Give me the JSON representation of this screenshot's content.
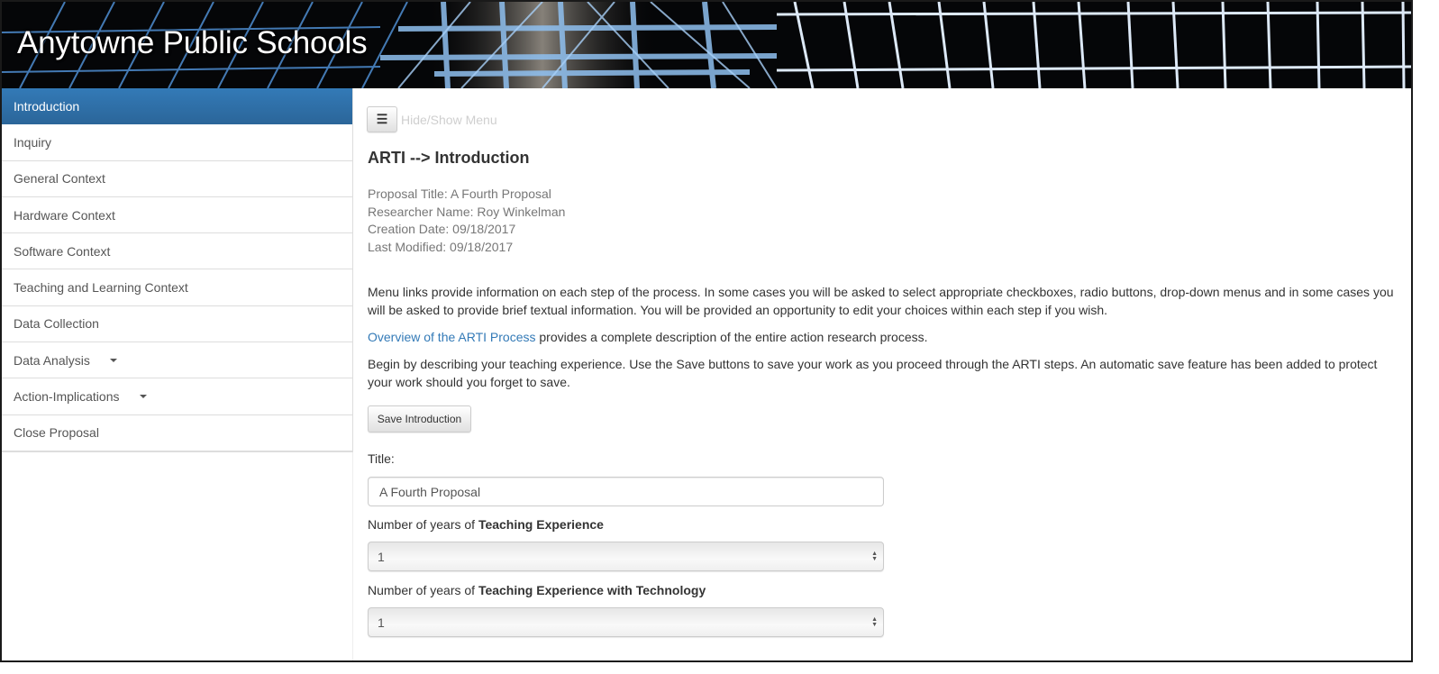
{
  "header": {
    "site_title": "Anytowne Public Schools"
  },
  "sidebar": {
    "items": [
      {
        "label": "Introduction",
        "active": true,
        "has_dropdown": false
      },
      {
        "label": "Inquiry",
        "active": false,
        "has_dropdown": false
      },
      {
        "label": "General Context",
        "active": false,
        "has_dropdown": false
      },
      {
        "label": "Hardware Context",
        "active": false,
        "has_dropdown": false
      },
      {
        "label": "Software Context",
        "active": false,
        "has_dropdown": false
      },
      {
        "label": "Teaching and Learning Context",
        "active": false,
        "has_dropdown": false
      },
      {
        "label": "Data Collection",
        "active": false,
        "has_dropdown": false
      },
      {
        "label": "Data Analysis",
        "active": false,
        "has_dropdown": true
      },
      {
        "label": "Action-Implications",
        "active": false,
        "has_dropdown": true
      },
      {
        "label": "Close Proposal",
        "active": false,
        "has_dropdown": false
      }
    ]
  },
  "toolbar": {
    "menu_icon": "hamburger-icon",
    "menu_glyph": "☰",
    "menu_toggle_label": "Hide/Show Menu"
  },
  "main": {
    "heading": "ARTI --> Introduction",
    "meta": {
      "proposal_title": "Proposal Title: A Fourth Proposal",
      "researcher_name": "Researcher Name: Roy Winkelman",
      "creation_date": "Creation Date: 09/18/2017",
      "last_modified": "Last Modified: 09/18/2017"
    },
    "paragraph1": "Menu links provide information on each step of the process. In some cases you will be asked to select appropriate checkboxes, radio buttons, drop-down menus and in some cases you will be asked to provide brief textual information. You will be provided an opportunity to edit your choices within each step if you wish.",
    "overview_link": "Overview of the ARTI Process",
    "paragraph2_rest": " provides a complete description of the entire action research process.",
    "paragraph3": "Begin by describing your teaching experience. Use the Save buttons to save your work as you proceed through the ARTI steps. An automatic save feature has been added to protect your work should you forget to save.",
    "save_button": "Save Introduction",
    "form": {
      "title_label": "Title:",
      "title_value": "A Fourth Proposal",
      "teaching_exp_label_prefix": "Number of years of ",
      "teaching_exp_label_bold": "Teaching Experience",
      "teaching_exp_value": "1",
      "tech_exp_label_prefix": "Number of years of ",
      "tech_exp_label_bold": "Teaching Experience with Technology",
      "tech_exp_value": "1"
    }
  },
  "colors": {
    "active_nav": "#337ab7",
    "link": "#337ab7",
    "meta_text": "#777777",
    "banner_bg": "#050608",
    "banner_accent": "#8fc0f0"
  }
}
